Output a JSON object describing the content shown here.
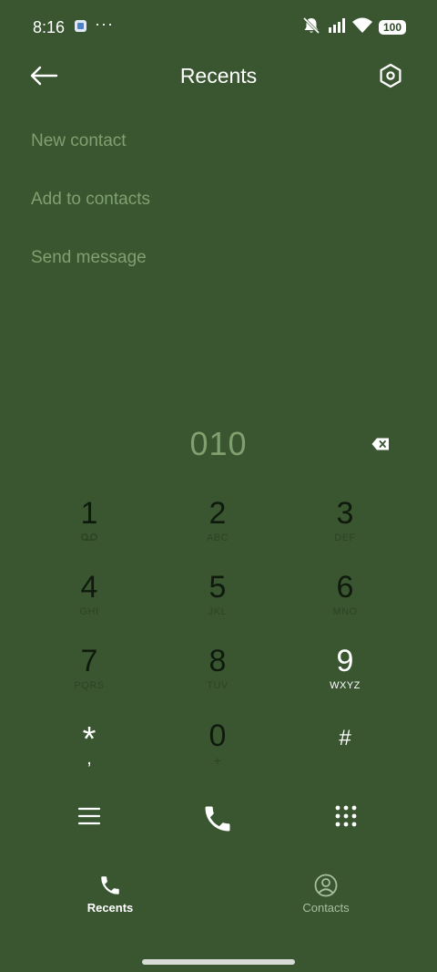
{
  "status_bar": {
    "time": "8:16",
    "more": "···",
    "battery": "100",
    "icons": [
      "app-notification-icon",
      "muted-bell-icon",
      "signal-icon",
      "wifi-icon",
      "battery-icon"
    ]
  },
  "header": {
    "title": "Recents"
  },
  "menu": {
    "items": [
      {
        "label": "New contact"
      },
      {
        "label": "Add to contacts"
      },
      {
        "label": "Send message"
      }
    ]
  },
  "dialer": {
    "number": "010",
    "keys": [
      {
        "digit": "1",
        "sub": ""
      },
      {
        "digit": "2",
        "sub": "ABC"
      },
      {
        "digit": "3",
        "sub": "DEF"
      },
      {
        "digit": "4",
        "sub": "GHI"
      },
      {
        "digit": "5",
        "sub": "JKL"
      },
      {
        "digit": "6",
        "sub": "MNO"
      },
      {
        "digit": "7",
        "sub": "PQRS"
      },
      {
        "digit": "8",
        "sub": "TUV"
      },
      {
        "digit": "9",
        "sub": "WXYZ"
      },
      {
        "digit": "*",
        "sub": ","
      },
      {
        "digit": "0",
        "sub": "+"
      },
      {
        "digit": "#",
        "sub": ""
      }
    ]
  },
  "bottom_nav": {
    "items": [
      {
        "label": "Recents",
        "active": true
      },
      {
        "label": "Contacts",
        "active": false
      }
    ]
  },
  "colors": {
    "background": "#3a5631",
    "muted_text": "#7fa06f",
    "key_digit": "#0f1a0d",
    "key_sub": "#2c4424"
  }
}
